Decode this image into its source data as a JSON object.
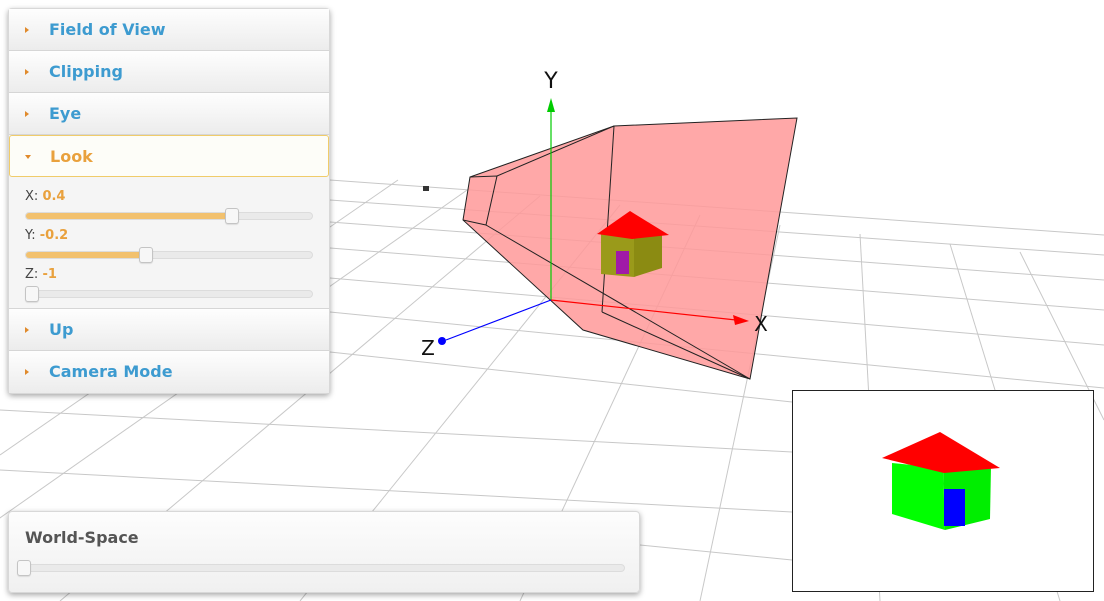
{
  "accordion": {
    "sections": [
      {
        "label": "Field of View",
        "expanded": false
      },
      {
        "label": "Clipping",
        "expanded": false
      },
      {
        "label": "Eye",
        "expanded": false
      },
      {
        "label": "Look",
        "expanded": true
      },
      {
        "label": "Up",
        "expanded": false
      },
      {
        "label": "Camera Mode",
        "expanded": false
      }
    ],
    "look_sliders": [
      {
        "axis": "X:",
        "value": "0.4",
        "fraction": 0.7
      },
      {
        "axis": "Y:",
        "value": "-0.2",
        "fraction": 0.4
      },
      {
        "axis": "Z:",
        "value": "-1",
        "fraction": 0.0
      }
    ]
  },
  "world_space": {
    "title": "World-Space",
    "slider_fraction": 0.0
  },
  "scene": {
    "axis_labels": {
      "x": "X",
      "y": "Y",
      "z": "Z"
    },
    "colors": {
      "x_axis": "#ff0000",
      "y_axis": "#00cc00",
      "z_axis": "#0000ff",
      "frustum_fill": "#ff9999",
      "roof": "#ff0000",
      "walls_scene": "#9a9a1a",
      "door_scene": "#9a1aa0",
      "walls_inset": "#00ff00",
      "door_inset": "#0000ff"
    }
  }
}
